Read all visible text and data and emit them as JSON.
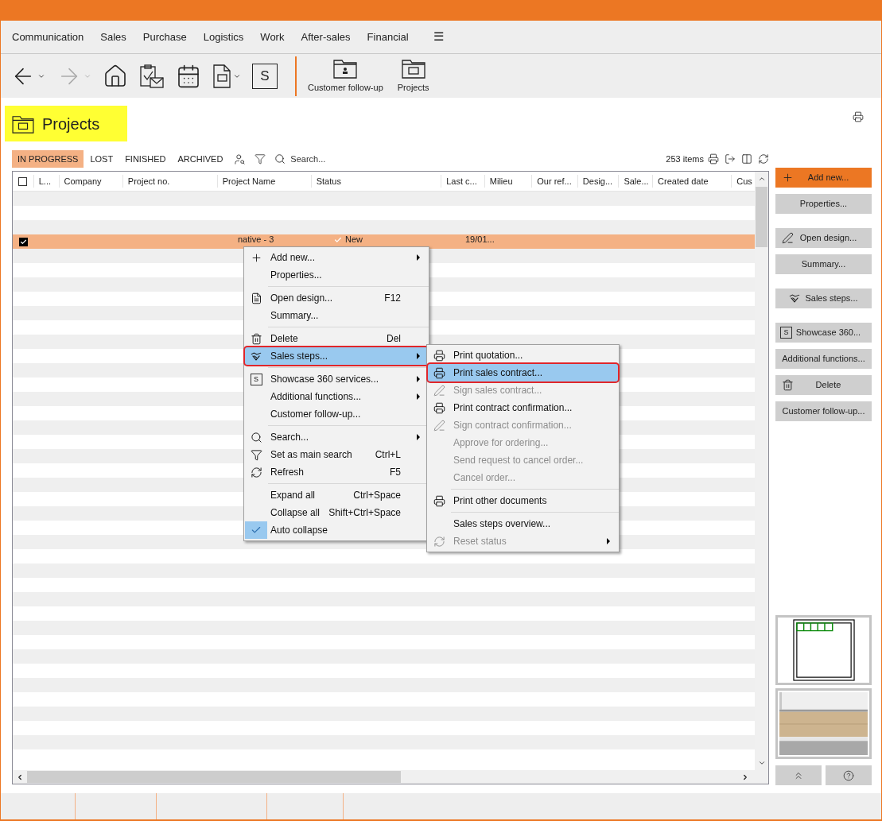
{
  "menu_bar": {
    "items": [
      {
        "label": "Communication"
      },
      {
        "label": "Sales"
      },
      {
        "label": "Purchase"
      },
      {
        "label": "Logistics"
      },
      {
        "label": "Work"
      },
      {
        "label": "After-sales"
      },
      {
        "label": "Financial"
      },
      {
        "label": "☰"
      }
    ]
  },
  "toolbar": {
    "items": [
      {
        "kind": "back",
        "dropdown": true,
        "disabled": false
      },
      {
        "kind": "forward",
        "dropdown": true,
        "disabled": true
      },
      {
        "kind": "home",
        "dropdown": false,
        "disabled": false
      },
      {
        "kind": "tasks",
        "dropdown": false,
        "disabled": false
      },
      {
        "kind": "calendar",
        "dropdown": false,
        "disabled": false
      },
      {
        "kind": "document",
        "dropdown": true,
        "disabled": false
      },
      {
        "kind": "showcase",
        "text": "S",
        "dropdown": false,
        "disabled": false
      },
      {
        "kind": "separator"
      },
      {
        "kind": "customer",
        "label": "Customer follow-up",
        "dropdown": false,
        "disabled": false
      },
      {
        "kind": "projects",
        "label": "Projects",
        "dropdown": false,
        "disabled": false
      }
    ]
  },
  "page": {
    "title": "Projects"
  },
  "filter_tabs": [
    {
      "label": "IN PROGRESS",
      "selected": true
    },
    {
      "label": "LOST",
      "selected": false
    },
    {
      "label": "FINISHED",
      "selected": false
    },
    {
      "label": "ARCHIVED",
      "selected": false
    }
  ],
  "search": {
    "placeholder": "Search..."
  },
  "item_count": "253 items",
  "table": {
    "select_all": {
      "checked": false
    },
    "columns": [
      "L...",
      "Company",
      "Project no.",
      "Project Name",
      "Status",
      "Last c...",
      "Milieu",
      "Our ref...",
      "Desig...",
      "Sale...",
      "Created date",
      "Cus"
    ],
    "rows": [
      {
        "selected": true,
        "checked": true,
        "project_name": "native - 3",
        "status": "New",
        "last_c": "19/01..."
      }
    ]
  },
  "context_menu": {
    "items": [
      {
        "kind": "plus",
        "label": "Add new...",
        "submenu": true,
        "selected": false,
        "checked": false
      },
      {
        "kind": "plain",
        "label": "Properties...",
        "submenu": false,
        "selected": false,
        "checked": false
      },
      {
        "kind": "separator"
      },
      {
        "kind": "design",
        "label": "Open design...",
        "shortcut": "F12",
        "submenu": false,
        "selected": false,
        "checked": false
      },
      {
        "kind": "plain",
        "label": "Summary...",
        "submenu": false,
        "selected": false,
        "checked": false
      },
      {
        "kind": "separator"
      },
      {
        "kind": "trash",
        "label": "Delete",
        "shortcut": "Del",
        "submenu": false,
        "selected": false,
        "checked": false
      },
      {
        "kind": "steps",
        "label": "Sales steps...",
        "submenu": true,
        "selected": true,
        "checked": false
      },
      {
        "kind": "separator"
      },
      {
        "kind": "sbox",
        "icon_text": "S",
        "label": "Showcase 360 services...",
        "submenu": true,
        "selected": false,
        "checked": false
      },
      {
        "kind": "plain",
        "label": "Additional functions...",
        "submenu": true,
        "selected": false,
        "checked": false
      },
      {
        "kind": "plain",
        "label": "Customer follow-up...",
        "submenu": false,
        "selected": false,
        "checked": false
      },
      {
        "kind": "separator"
      },
      {
        "kind": "search",
        "label": "Search...",
        "submenu": true,
        "selected": false,
        "checked": false
      },
      {
        "kind": "filter",
        "label": "Set as main search",
        "shortcut": "Ctrl+L",
        "submenu": false,
        "selected": false,
        "checked": false
      },
      {
        "kind": "refresh",
        "label": "Refresh",
        "shortcut": "F5",
        "submenu": false,
        "selected": false,
        "checked": false
      },
      {
        "kind": "separator"
      },
      {
        "kind": "plain",
        "label": "Expand all",
        "shortcut": "Ctrl+Space",
        "submenu": false,
        "selected": false,
        "checked": false
      },
      {
        "kind": "plain",
        "label": "Collapse all",
        "shortcut": "Shift+Ctrl+Space",
        "submenu": false,
        "selected": false,
        "checked": false
      },
      {
        "kind": "plain",
        "label": "Auto collapse",
        "submenu": false,
        "selected": false,
        "checked": true
      }
    ]
  },
  "submenu": {
    "items": [
      {
        "kind": "printer",
        "label": "Print quotation...",
        "submenu": false,
        "selected": false,
        "disabled": false
      },
      {
        "kind": "printer",
        "label": "Print sales contract...",
        "submenu": false,
        "selected": true,
        "disabled": false
      },
      {
        "kind": "pen",
        "label": "Sign sales contract...",
        "submenu": false,
        "selected": false,
        "disabled": true
      },
      {
        "kind": "printer",
        "label": "Print contract confirmation...",
        "submenu": false,
        "selected": false,
        "disabled": false
      },
      {
        "kind": "pen",
        "label": "Sign contract confirmation...",
        "submenu": false,
        "selected": false,
        "disabled": true
      },
      {
        "kind": "plain",
        "label": "Approve for ordering...",
        "submenu": false,
        "selected": false,
        "disabled": true
      },
      {
        "kind": "plain",
        "label": "Send request to cancel order...",
        "submenu": false,
        "selected": false,
        "disabled": true
      },
      {
        "kind": "plain",
        "label": "Cancel order...",
        "submenu": false,
        "selected": false,
        "disabled": true
      },
      {
        "kind": "separator"
      },
      {
        "kind": "printer",
        "label": "Print other documents",
        "submenu": false,
        "selected": false,
        "disabled": false
      },
      {
        "kind": "separator"
      },
      {
        "kind": "plain",
        "label": "Sales steps overview...",
        "submenu": false,
        "selected": false,
        "disabled": false
      },
      {
        "kind": "refresh",
        "label": "Reset status",
        "submenu": true,
        "selected": false,
        "disabled": true
      }
    ]
  },
  "side_buttons": [
    {
      "kind": "plus",
      "primary": true,
      "label": "Add new..."
    },
    {
      "kind": "plain",
      "primary": false,
      "label": "Properties..."
    },
    {
      "kind": "gap"
    },
    {
      "kind": "pen",
      "primary": false,
      "label": "Open design..."
    },
    {
      "kind": "plain",
      "primary": false,
      "label": "Summary..."
    },
    {
      "kind": "gap"
    },
    {
      "kind": "steps",
      "primary": false,
      "label": "Sales steps..."
    },
    {
      "kind": "gap"
    },
    {
      "kind": "sbox",
      "primary": false,
      "icon_text": "S",
      "label": "Showcase 360..."
    },
    {
      "kind": "plain",
      "primary": false,
      "label": "Additional functions..."
    },
    {
      "kind": "trash",
      "primary": false,
      "label": "Delete"
    },
    {
      "kind": "plain",
      "primary": false,
      "label": "Customer follow-up..."
    }
  ]
}
